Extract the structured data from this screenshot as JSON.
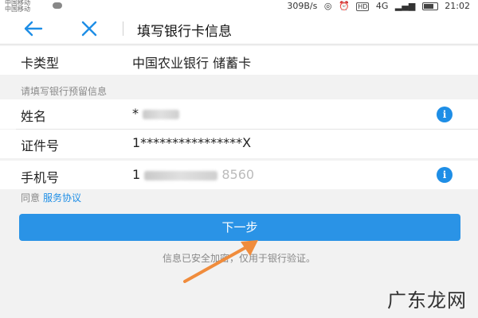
{
  "status_bar": {
    "carrier_1": "中国移动",
    "carrier_2": "中国移动",
    "net_speed": "309B/s",
    "hd": "HD",
    "network": "4G",
    "time": "21:02"
  },
  "header": {
    "title": "填写银行卡信息"
  },
  "card_type": {
    "label": "卡类型",
    "value": "中国农业银行 储蓄卡"
  },
  "section_hint": "请填写银行预留信息",
  "name_row": {
    "label": "姓名",
    "value_visible": "*"
  },
  "id_row": {
    "label": "证件号",
    "value": "1****************X"
  },
  "phone_row": {
    "label": "手机号",
    "value_prefix": "1",
    "value_suffix": "8560"
  },
  "agreement": {
    "prefix": "同意",
    "link": "服务协议"
  },
  "next_button": {
    "label": "下一步"
  },
  "secure_note": "信息已安全加密，仅用于银行验证。",
  "watermark": "广东龙网",
  "colors": {
    "accent": "#2a93e6",
    "arrow": "#f08c3c"
  }
}
